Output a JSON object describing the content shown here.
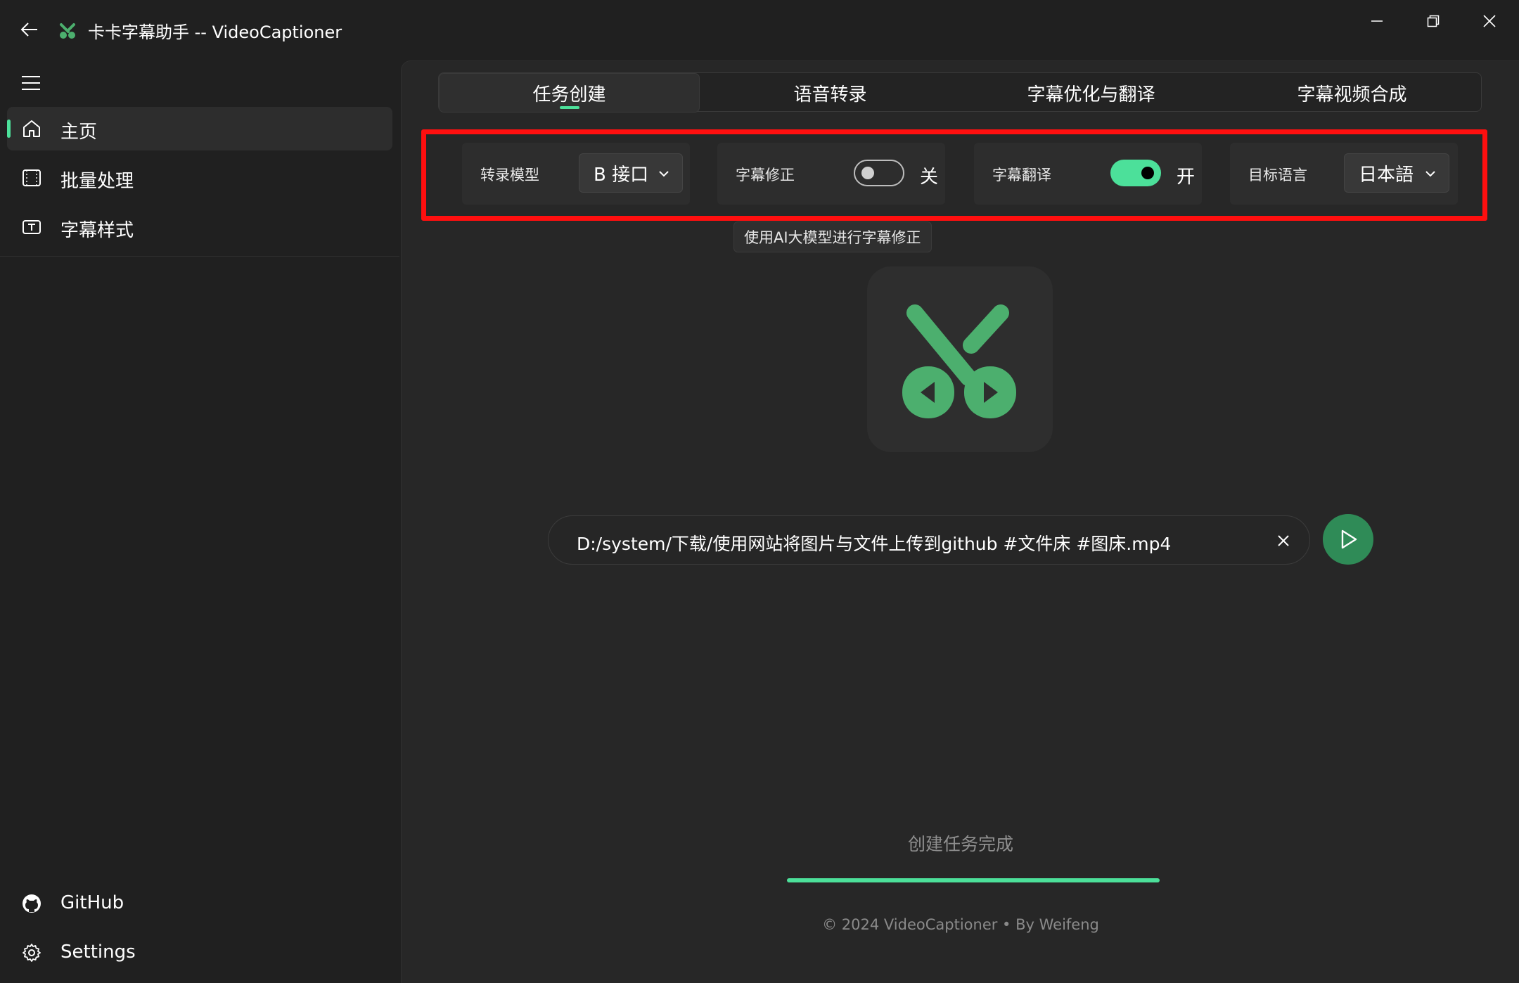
{
  "titlebar": {
    "title": "卡卡字幕助手 -- VideoCaptioner"
  },
  "sidebar": {
    "items": [
      {
        "label": "主页",
        "icon": "home-icon",
        "active": true
      },
      {
        "label": "批量处理",
        "icon": "film-icon",
        "active": false
      },
      {
        "label": "字幕样式",
        "icon": "text-style-icon",
        "active": false
      }
    ],
    "bottom_items": [
      {
        "label": "GitHub",
        "icon": "github-icon"
      },
      {
        "label": "Settings",
        "icon": "gear-icon"
      }
    ]
  },
  "tabs": [
    {
      "label": "任务创建",
      "active": true
    },
    {
      "label": "语音转录",
      "active": false
    },
    {
      "label": "字幕优化与翻译",
      "active": false
    },
    {
      "label": "字幕视频合成",
      "active": false
    }
  ],
  "config": {
    "transcribe_model": {
      "label": "转录模型",
      "value": "B 接口"
    },
    "subtitle_correction": {
      "label": "字幕修正",
      "state": "关",
      "enabled": false
    },
    "subtitle_translation": {
      "label": "字幕翻译",
      "state": "开",
      "enabled": true
    },
    "target_language": {
      "label": "目标语言",
      "value": "日本語"
    }
  },
  "tooltip": "使用AI大模型进行字幕修正",
  "file": {
    "path": "D:/system/下载/使用网站将图片与文件上传到github #文件床 #图床.mp4"
  },
  "status": {
    "text": "创建任务完成",
    "progress": 1.0
  },
  "footer": "© 2024 VideoCaptioner • By Weifeng",
  "colors": {
    "accent": "#4ce09a",
    "logo_green": "#4caf6e",
    "highlight_frame": "#ff0f0f",
    "run_button": "#2f8b57"
  }
}
